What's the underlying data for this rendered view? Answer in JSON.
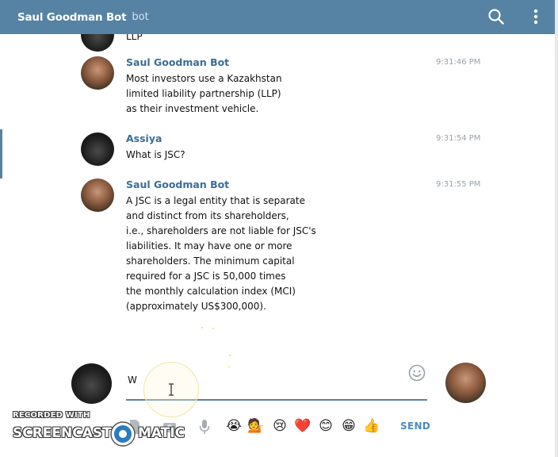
{
  "header": {
    "title": "Saul Goodman Bot",
    "subtitle": "bot",
    "search_icon": "search-icon",
    "menu_icon": "more-vertical-icon",
    "color": "#5682a3"
  },
  "messages": [
    {
      "partial_text": "LLP"
    },
    {
      "sender": "Saul Goodman Bot",
      "time": "9:31:46 PM",
      "text": "Most investors use a Kazakhstan\nlimited liability partnership (LLP)\nas their investment vehicle."
    },
    {
      "sender": "Assiya",
      "time": "9:31:54 PM",
      "text": "What is JSC?"
    },
    {
      "sender": "Saul Goodman Bot",
      "time": "9:31:55 PM",
      "text": "A JSC is a legal entity that is separate\nand distinct from its shareholders,\ni.e., shareholders are not liable for JSC's\nliabilities. It may have one or more\nshareholders. The minimum capital\nrequired for a JSC is 50,000 times\nthe monthly calculation index (MCI)\n(approximately US$300,000)."
    }
  ],
  "composer": {
    "input_value": "W",
    "send_label": "SEND",
    "emoji_icon": "smiley-icon",
    "toolbar_icons": [
      "document-icon",
      "camera-icon",
      "microphone-icon"
    ],
    "quick_emojis": [
      "😭",
      "💁",
      "😢",
      "❤️",
      "😊",
      "😁",
      "👍"
    ]
  },
  "watermark": {
    "line1": "RECORDED WITH",
    "left": "SCREENCAST",
    "right": "MATIC"
  }
}
